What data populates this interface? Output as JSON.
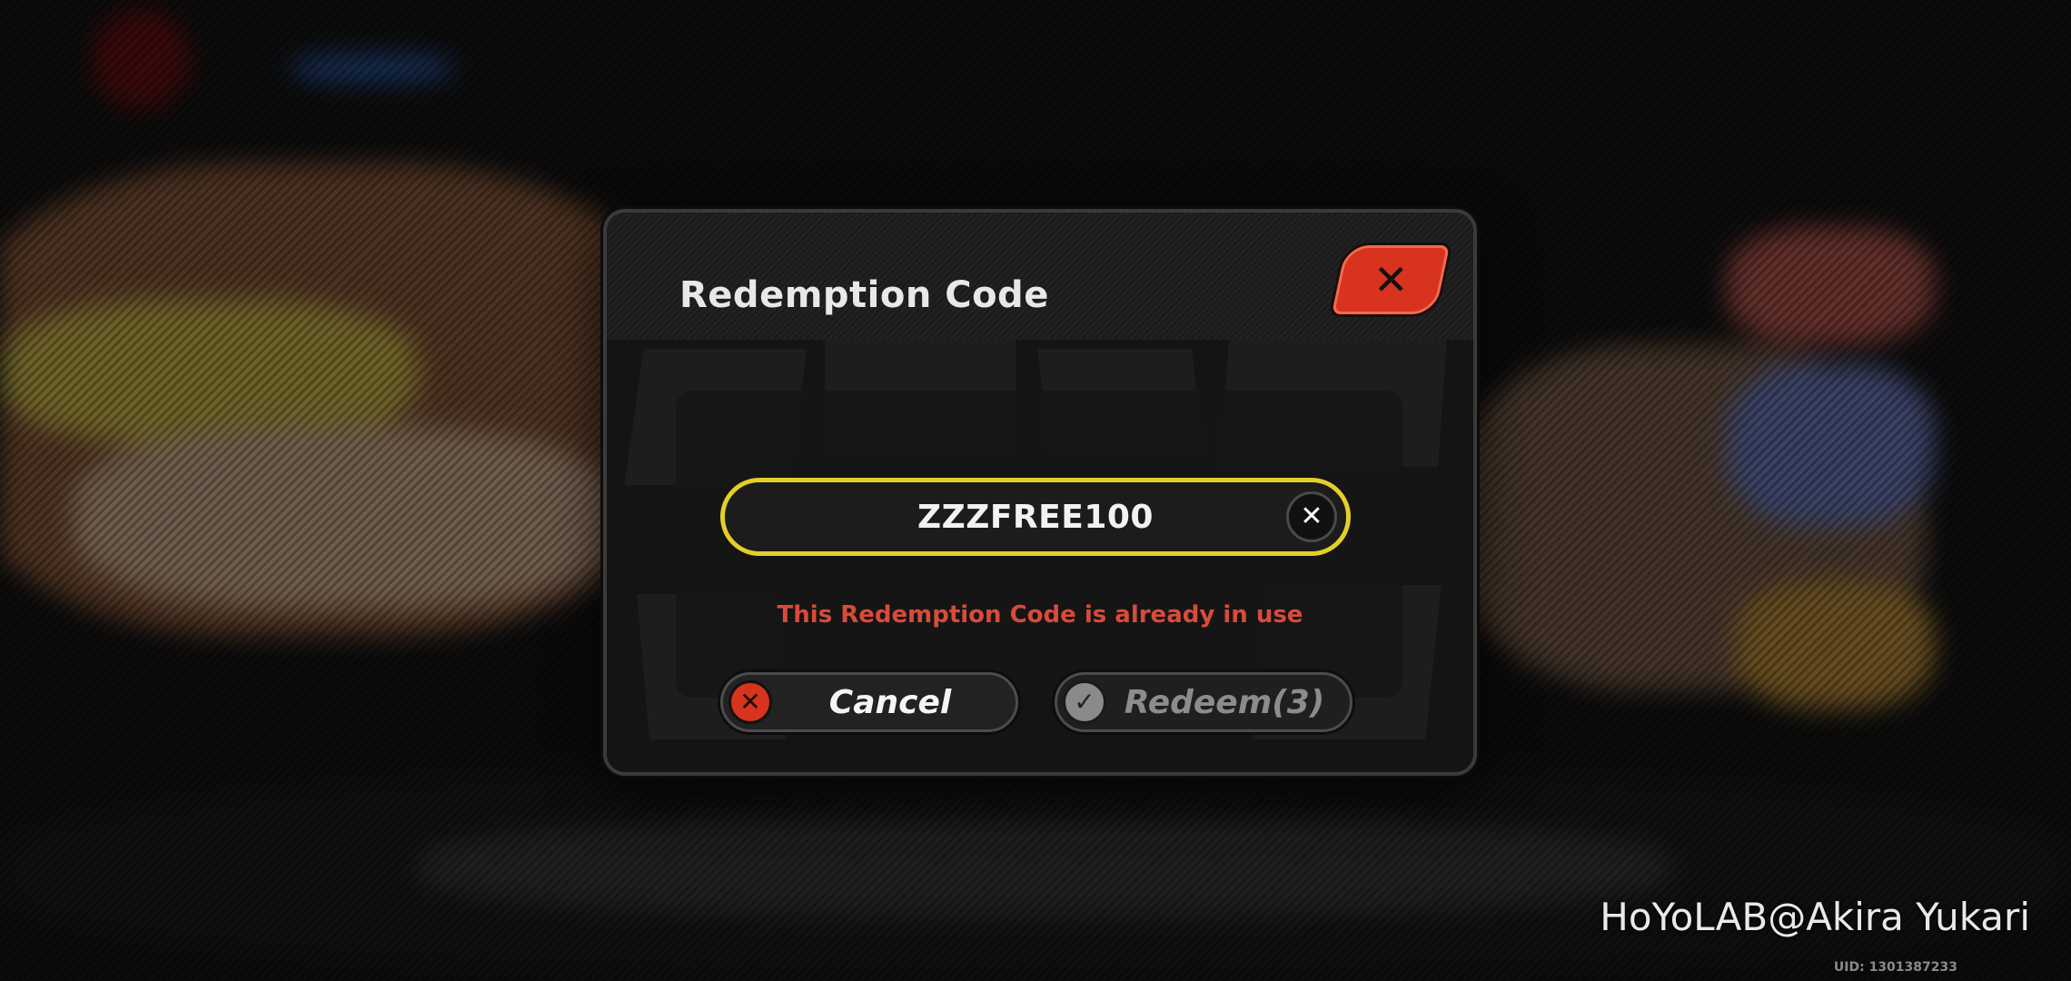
{
  "dialog": {
    "title": "Redemption Code",
    "close_icon": "close-icon"
  },
  "code_input": {
    "value": "ZZZFREE100",
    "clear_icon": "clear-icon"
  },
  "error_message": "This Redemption Code is already in use",
  "buttons": {
    "cancel_label": "Cancel",
    "cancel_icon": "x-circle-icon",
    "redeem_label": "Redeem(3)",
    "redeem_icon": "check-circle-icon"
  },
  "watermark": "HoYoLAB@Akira Yukari",
  "uid": "UID: 1301387233",
  "colors": {
    "accent_yellow": "#e4cf29",
    "close_red": "#d8331f",
    "error_red": "#d84b3a",
    "disabled_gray": "#8c8c8c"
  }
}
